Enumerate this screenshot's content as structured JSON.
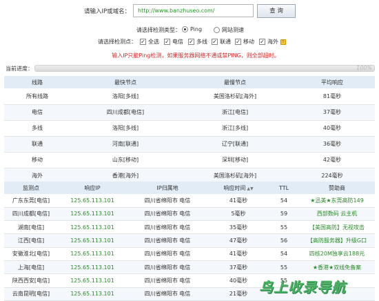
{
  "form": {
    "domain_label": "请输入IP或域名：",
    "domain_value": "http://www.banzhuseo.com/",
    "query_label": "查 询",
    "type_label": "请选择检测类型：",
    "type_options": [
      {
        "label": "Ping",
        "checked": true
      },
      {
        "label": "网站测速",
        "checked": false
      }
    ],
    "points_label": "请选择检测点：",
    "points": [
      "全选",
      "电信",
      "多线",
      "联通",
      "移动",
      "海外"
    ],
    "notice": "输入IP只能Ping检测，如果服务器网络不通或禁PING，则全部超时。"
  },
  "progress": {
    "label": "当前进度：",
    "value_text": "100%",
    "value": 1.0
  },
  "summary": {
    "headers": [
      "线路",
      "最快节点",
      "最慢节点",
      "平均响应"
    ],
    "rows": [
      [
        "所有线路",
        "洛阳[多线]",
        "美国洛杉矶[海外]",
        "81毫秒"
      ],
      [
        "电信",
        "四川成都[电信]",
        "浙江[电信]",
        "37毫秒"
      ],
      [
        "多线",
        "洛阳[多线]",
        "浙江[多线]",
        "40毫秒"
      ],
      [
        "联通",
        "河南[联通]",
        "辽宁[联通]",
        "36毫秒"
      ],
      [
        "移动",
        "山东[移动]",
        "深圳[移动]",
        "42毫秒"
      ],
      [
        "海外",
        "香港[海外]",
        "美国洛杉矶[海外]",
        "224毫秒"
      ]
    ]
  },
  "detail": {
    "headers": [
      "监测点",
      "响应IP",
      "IP归属地",
      "响应时间",
      "TTL",
      "赞助商"
    ],
    "sort_icon": "sort-icon",
    "rows": [
      [
        "广东东莞[电信]",
        "125.65.113.101",
        "四川省绵阳市 电信",
        "41毫秒",
        "54",
        "★迅美★东莞高防149"
      ],
      [
        "四川成都[电信]",
        "125.65.113.101",
        "四川省绵阳市 电信",
        "5毫秒",
        "59",
        "西部数码 云主机"
      ],
      [
        "湖南[电信]",
        "125.65.113.101",
        "四川省绵阳市 电信",
        "35毫秒",
        "55",
        "【美国高防】无视攻击"
      ],
      [
        "江西[电信]",
        "125.65.113.101",
        "四川省绵阳市 电信",
        "47毫秒",
        "56",
        "【高防服务器】升级G口"
      ],
      [
        "安徽淮北[电信]",
        "125.65.113.101",
        "四川省绵阳市 电信",
        "41毫秒",
        "54",
        "四核20M独享云188元"
      ],
      [
        "上海[电信]",
        "125.65.113.101",
        "四川省绵阳市 电信",
        "37毫秒",
        "55",
        "★香港★双线免备案"
      ],
      [
        "陕西西安[电信]",
        "125.65.113.101",
        "四川省绵阳市 电信",
        "40毫秒",
        "55",
        ""
      ],
      [
        "云南昆明[电信]",
        "125.65.113.101",
        "四川省绵阳市 电信",
        "21毫秒",
        "",
        ""
      ]
    ]
  },
  "watermark": "鸟上收录导航",
  "colors": {
    "header_bg": "#e1ecf7",
    "notice_red": "#d42a2a",
    "ip_green": "#2a8a2a"
  }
}
